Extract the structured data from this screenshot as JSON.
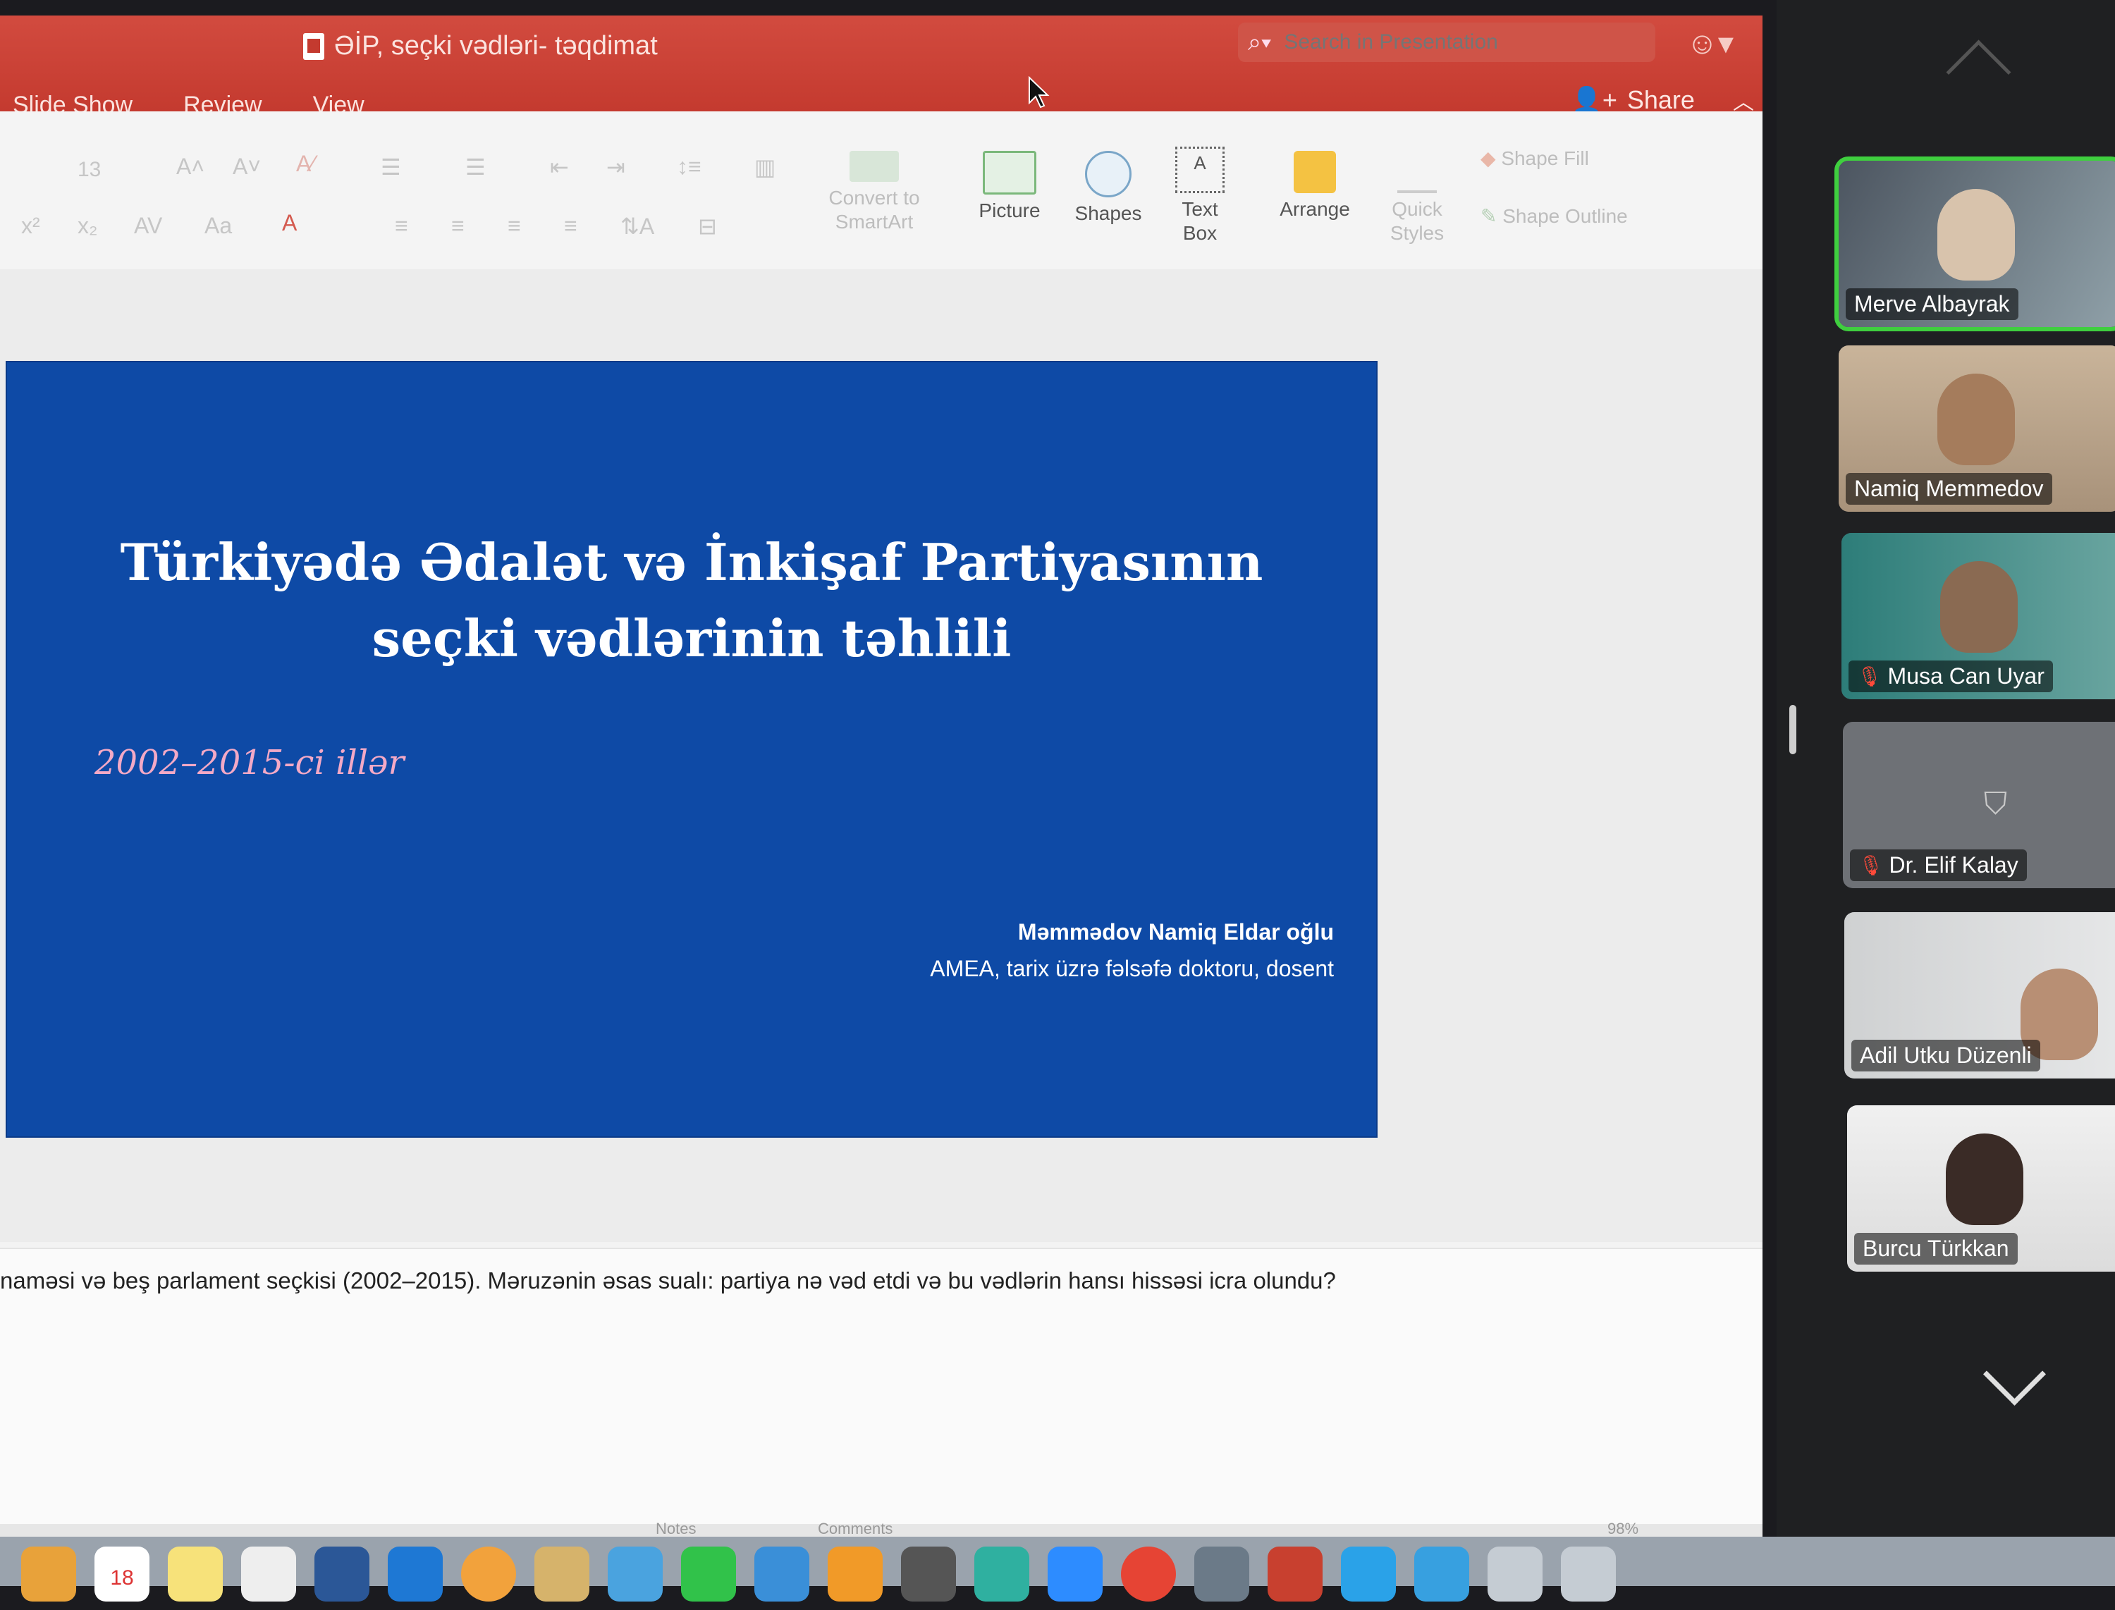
{
  "window": {
    "title": "ƏİP, seçki vədləri- təqdimat",
    "search_placeholder": "Search in Presentation",
    "menu_tabs": [
      "Slide Show",
      "Review",
      "View"
    ],
    "share_label": "Share"
  },
  "ribbon": {
    "font_size": "13",
    "convert_label": "Convert to SmartArt",
    "picture_label": "Picture",
    "shapes_label": "Shapes",
    "textbox_label": "Text Box",
    "arrange_label": "Arrange",
    "quickstyles_label": "Quick Styles",
    "shape_fill_label": "Shape Fill",
    "shape_outline_label": "Shape Outline"
  },
  "slide": {
    "title_line1": "Türkiyədə Ədalət və İnkişaf Partiyasının",
    "title_line2": "seçki vədlərinin təhlili",
    "subtitle": "2002–2015-ci illər",
    "author_line1": "Məmmədov Namiq Eldar oğlu",
    "author_line2": "AMEA, tarix üzrə fəlsəfə doktoru, dosent"
  },
  "notes": {
    "text": "naməsi və beş parlament seçkisi (2002–2015). Məruzənin əsas sualı: partiya nə vəd etdi və bu vədlərin hansı hissəsi icra olundu?"
  },
  "statusbar": {
    "notes_label": "Notes",
    "comments_label": "Comments",
    "zoom": "98%"
  },
  "participants": [
    {
      "name": "Merve Albayrak",
      "muted": false,
      "active": true
    },
    {
      "name": "Namiq Memmedov",
      "muted": false,
      "active": false
    },
    {
      "name": "Musa Can Uyar",
      "muted": true,
      "active": false
    },
    {
      "name": "Dr. Elif Kalay",
      "muted": true,
      "active": false
    },
    {
      "name": "Adil Utku Düzenli",
      "muted": false,
      "active": false
    },
    {
      "name": "Burcu Türkkan",
      "muted": false,
      "active": false
    }
  ],
  "dock_badge": "18",
  "colors": {
    "titlebar": "#c43a2f",
    "slide_bg": "#0e4aa6",
    "subtitle": "#f3a9c6",
    "active_speaker": "#3fcf3f"
  }
}
